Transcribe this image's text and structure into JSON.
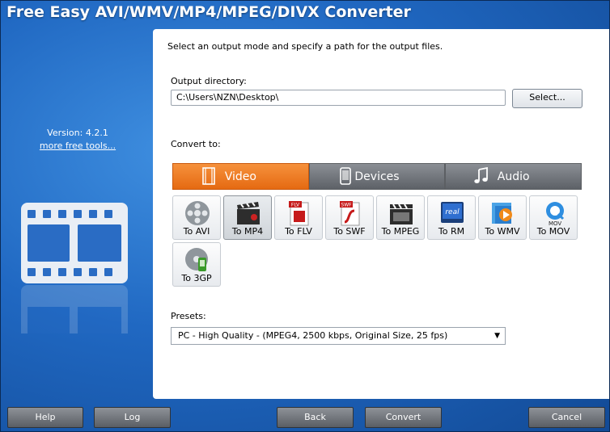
{
  "app": {
    "title": "Free Easy AVI/WMV/MP4/MPEG/DIVX Converter"
  },
  "sidebar": {
    "version": "Version: 4.2.1",
    "more_tools": "more free tools..."
  },
  "main": {
    "instruction": "Select an output mode and specify a path for the output files.",
    "output_directory": {
      "label": "Output directory:",
      "value": "C:\\Users\\NZN\\Desktop\\",
      "select_label": "Select..."
    },
    "convert_to_label": "Convert to:",
    "tabs": [
      {
        "label": "Video",
        "icon": "film-strip-icon",
        "active": true
      },
      {
        "label": "Devices",
        "icon": "phone-icon",
        "active": false
      },
      {
        "label": "Audio",
        "icon": "music-note-icon",
        "active": false
      }
    ],
    "formats": [
      {
        "label": "To AVI",
        "icon": "film-reel-icon",
        "selected": false
      },
      {
        "label": "To MP4",
        "icon": "clapperboard-icon",
        "selected": true
      },
      {
        "label": "To FLV",
        "icon": "flv-file-icon",
        "selected": false
      },
      {
        "label": "To SWF",
        "icon": "swf-file-icon",
        "selected": false
      },
      {
        "label": "To MPEG",
        "icon": "mpeg-clapper-icon",
        "selected": false
      },
      {
        "label": "To RM",
        "icon": "realmedia-icon",
        "selected": false
      },
      {
        "label": "To WMV",
        "icon": "wmv-player-icon",
        "selected": false
      },
      {
        "label": "To MOV",
        "icon": "quicktime-icon",
        "selected": false
      },
      {
        "label": "To 3GP",
        "icon": "mobile-film-icon",
        "selected": false
      }
    ],
    "presets": {
      "label": "Presets:",
      "value": "PC - High Quality - (MPEG4, 2500 kbps, Original Size, 25 fps)"
    }
  },
  "footer": {
    "help": "Help",
    "log": "Log",
    "back": "Back",
    "convert": "Convert",
    "cancel": "Cancel"
  },
  "colors": {
    "accent_orange": "#e56a12",
    "background_blue": "#2068c2",
    "panel": "#ffffff"
  }
}
